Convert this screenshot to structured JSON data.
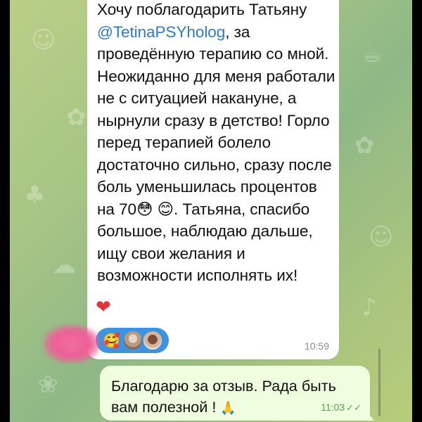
{
  "incoming_message": {
    "text_before_mention": "Хочу поблагодарить Татьяну ",
    "mention": "@TetinaPSYholog",
    "text_after_mention": ", за проведённую терапию со мной. Неожиданно для меня работали не с ситуацией накануне, а нырнули сразу в детство! Горло перед терапией болело достаточно сильно, сразу после боль уменьшилась процентов на 70😳 😊. Татьяна, спасибо большое, наблюдаю дальше, ищу свои желания и возможности исполнять их!",
    "heart": "❤",
    "time": "10:59",
    "reactions": {
      "emoji": "🥰",
      "reaction_icon": "smiling-face-with-hearts-icon",
      "avatar_count": 2
    }
  },
  "outgoing_message": {
    "text": "Благодарю за отзыв. Рада быть вам полезной ! ",
    "pray_emoji": "🙏",
    "time": "11:03",
    "checks": "✓✓",
    "status_icon": "double-check-icon"
  },
  "colors": {
    "incoming_bubble": "#ffffff",
    "outgoing_bubble": "#eefedf",
    "mention_link": "#2f7bc6",
    "reaction_pill": "#3d93df",
    "outgoing_meta": "#55a64a",
    "chat_background": "#a7c585"
  }
}
